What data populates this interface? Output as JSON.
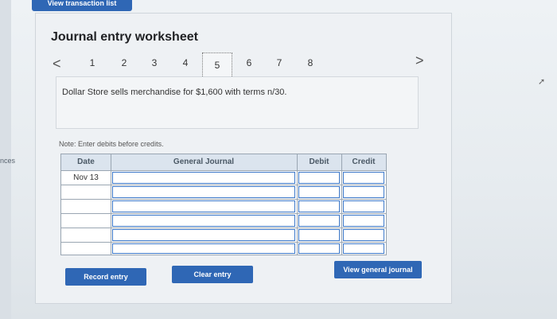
{
  "top_tab": {
    "label": "View transaction list"
  },
  "side_text": "nces",
  "title": "Journal entry worksheet",
  "nav": {
    "prev": "<",
    "next": ">",
    "steps": [
      "1",
      "2",
      "3",
      "4",
      "5",
      "6",
      "7",
      "8"
    ],
    "active_step": "5"
  },
  "prompt": "Dollar Store sells merchandise for $1,600 with terms n/30.",
  "note": "Note: Enter debits before credits.",
  "journal": {
    "headers": {
      "date": "Date",
      "account": "General Journal",
      "debit": "Debit",
      "credit": "Credit"
    },
    "rows": [
      {
        "date": "Nov 13"
      },
      {
        "date": ""
      },
      {
        "date": ""
      },
      {
        "date": ""
      },
      {
        "date": ""
      },
      {
        "date": ""
      }
    ]
  },
  "buttons": {
    "record": "Record entry",
    "clear": "Clear entry",
    "view": "View general journal"
  },
  "colors": {
    "accent": "#2f67b5",
    "input_border": "#3c78c9"
  }
}
